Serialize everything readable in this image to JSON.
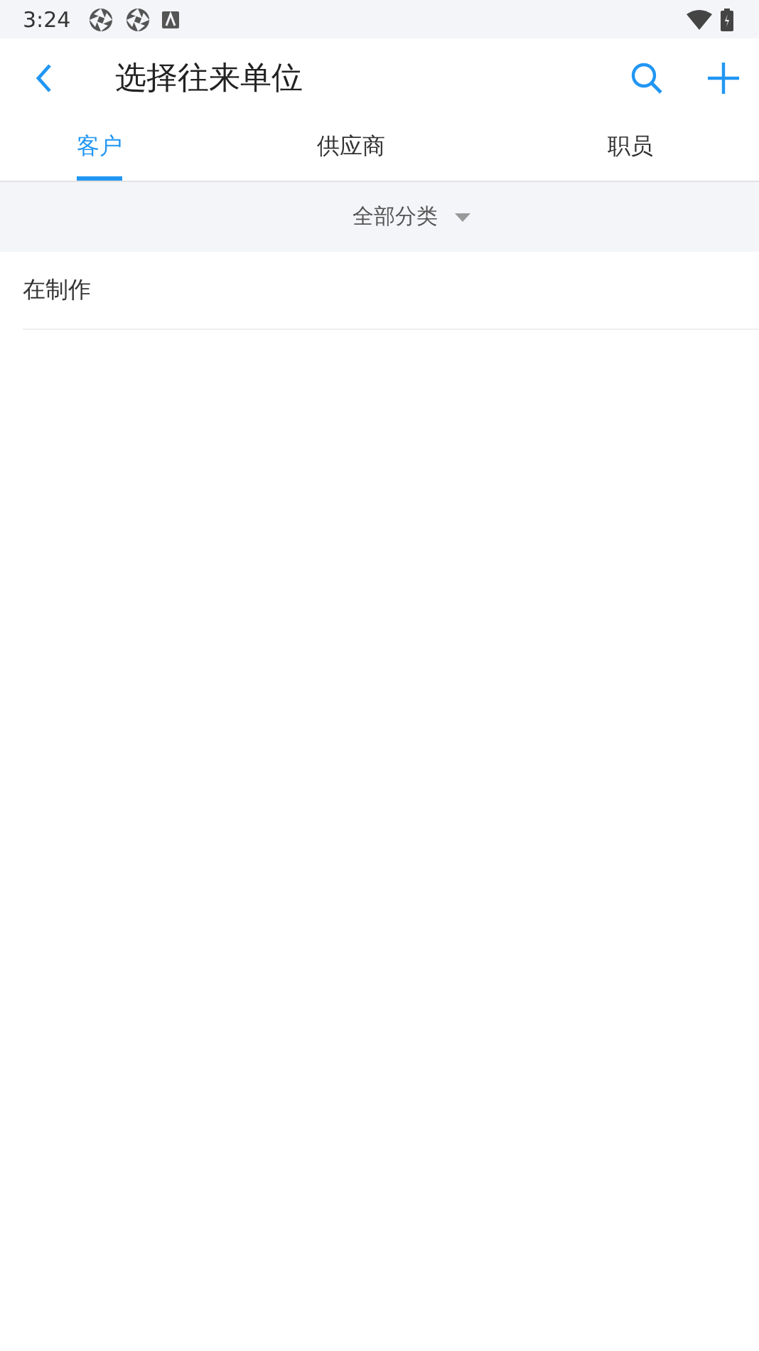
{
  "status_bar": {
    "time": "3:24"
  },
  "header": {
    "title": "选择往来单位"
  },
  "tabs": [
    {
      "label": "客户",
      "selected": true
    },
    {
      "label": "供应商",
      "selected": false
    },
    {
      "label": "职员",
      "selected": false
    }
  ],
  "filter": {
    "label": "全部分类"
  },
  "items": [
    {
      "name": "在制作"
    }
  ]
}
